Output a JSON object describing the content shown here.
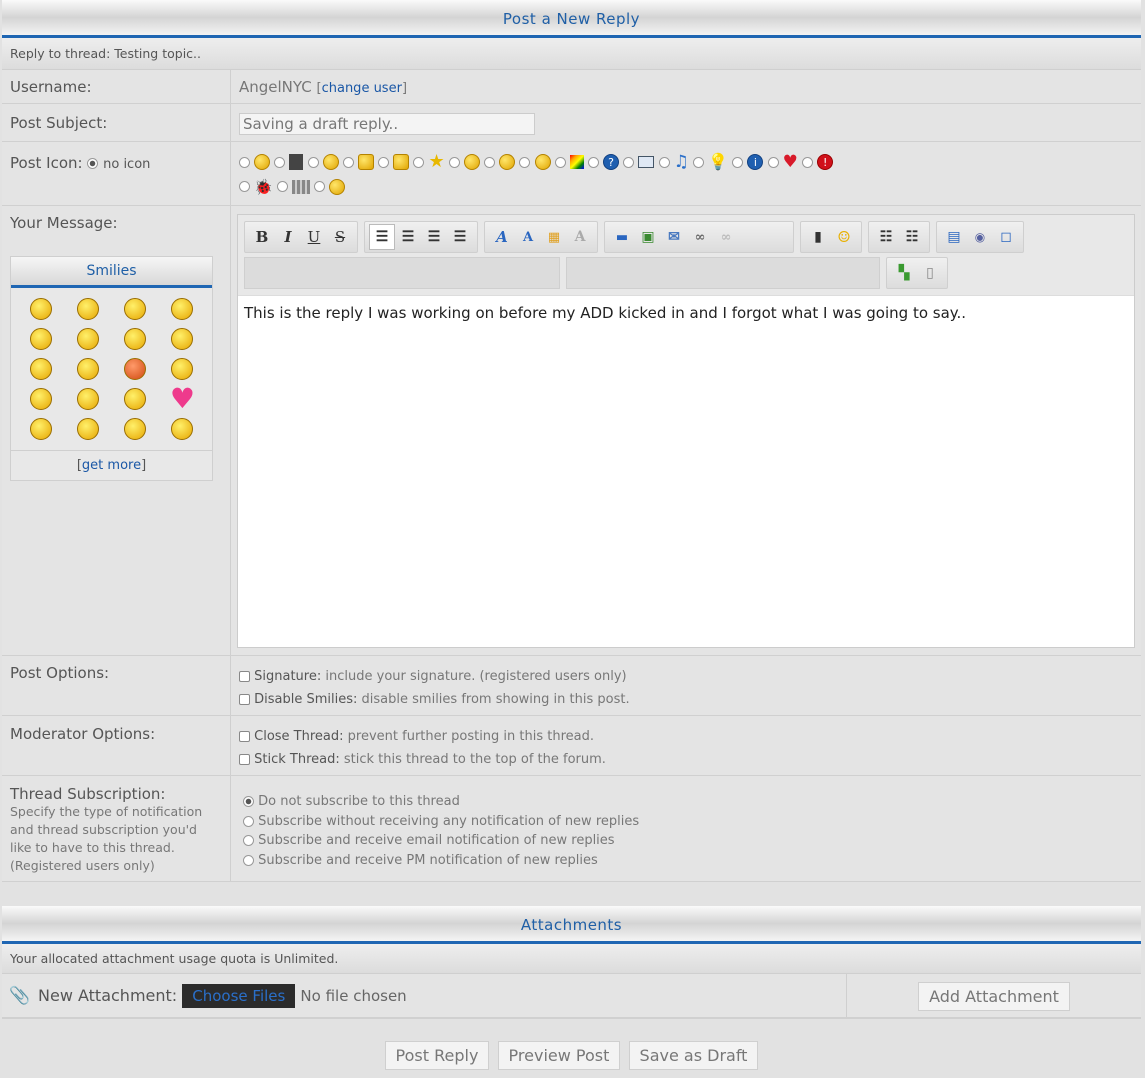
{
  "header": {
    "title": "Post a New Reply"
  },
  "thread": {
    "label": "Reply to thread:",
    "title": "Testing topic.."
  },
  "username": {
    "label": "Username:",
    "value": "AngelNYC",
    "change": "change user"
  },
  "subject": {
    "label": "Post Subject:",
    "value": "Saving a draft reply.."
  },
  "post_icon": {
    "label": "Post Icon:",
    "none": "no icon"
  },
  "message": {
    "label": "Your Message:",
    "text": "This is the reply I was working on before my ADD kicked in and I forgot what I was going to say.."
  },
  "smilies": {
    "title": "Smilies",
    "more": "get more"
  },
  "post_options": {
    "label": "Post Options:",
    "sig_b": "Signature:",
    "sig_t": "include your signature. (registered users only)",
    "dis_b": "Disable Smilies:",
    "dis_t": "disable smilies from showing in this post."
  },
  "mod_options": {
    "label": "Moderator Options:",
    "close_b": "Close Thread:",
    "close_t": "prevent further posting in this thread.",
    "stick_b": "Stick Thread:",
    "stick_t": "stick this thread to the top of the forum."
  },
  "subscription": {
    "label": "Thread Subscription:",
    "desc": "Specify the type of notification and thread subscription you'd like to have to this thread. (Registered users only)",
    "opts": [
      "Do not subscribe to this thread",
      "Subscribe without receiving any notification of new replies",
      "Subscribe and receive email notification of new replies",
      "Subscribe and receive PM notification of new replies"
    ]
  },
  "attachments": {
    "title": "Attachments",
    "quota": "Your allocated attachment usage quota is Unlimited.",
    "new_label": "New Attachment:",
    "choose": "Choose Files",
    "none": "No file chosen",
    "add": "Add Attachment"
  },
  "buttons": {
    "post": "Post Reply",
    "preview": "Preview Post",
    "draft": "Save as Draft"
  }
}
